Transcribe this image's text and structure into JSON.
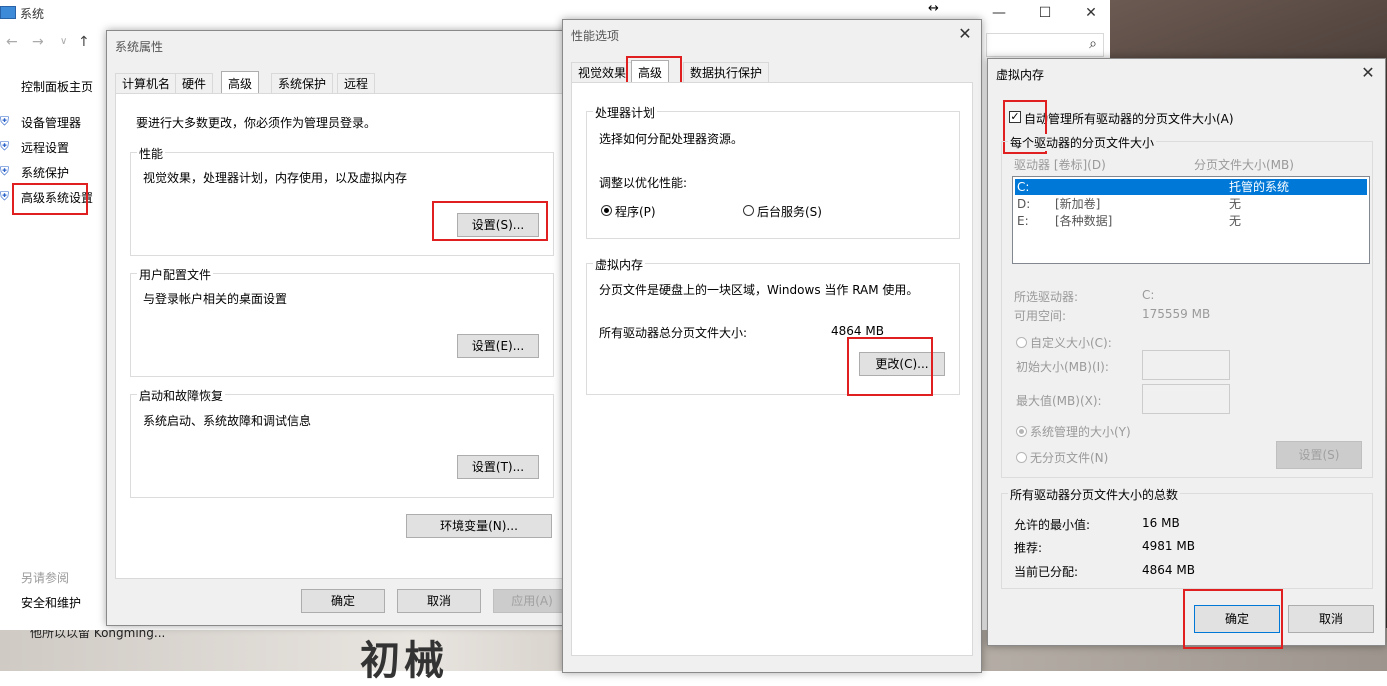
{
  "system_window": {
    "title": "系统",
    "control_panel_home": "控制面板主页",
    "sidebar_links": [
      "设备管理器",
      "远程设置",
      "系统保护",
      "高级系统设置"
    ],
    "see_also_title": "另请参阅",
    "see_also_link": "安全和维护",
    "min_glyph": "—",
    "max_glyph": "☐",
    "close_glyph": "✕",
    "resize_glyph": "↔",
    "search_glyph": "⌕"
  },
  "background": {
    "caption": "他所以以留   Kongming...",
    "big_text": "初械"
  },
  "system_properties": {
    "title": "系统属性",
    "tabs": [
      "计算机名",
      "硬件",
      "高级",
      "系统保护",
      "远程"
    ],
    "admin_note": "要进行大多数更改，你必须作为管理员登录。",
    "performance": {
      "label": "性能",
      "desc": "视觉效果，处理器计划，内存使用，以及虚拟内存",
      "button": "设置(S)..."
    },
    "user_profiles": {
      "label": "用户配置文件",
      "desc": "与登录帐户相关的桌面设置",
      "button": "设置(E)..."
    },
    "startup": {
      "label": "启动和故障恢复",
      "desc": "系统启动、系统故障和调试信息",
      "button": "设置(T)..."
    },
    "env_button": "环境变量(N)...",
    "ok": "确定",
    "cancel": "取消",
    "apply": "应用(A)"
  },
  "performance_options": {
    "title": "性能选项",
    "tabs": [
      "视觉效果",
      "高级",
      "数据执行保护"
    ],
    "processor": {
      "label": "处理器计划",
      "desc": "选择如何分配处理器资源。",
      "adjust": "调整以优化性能:",
      "opt_programs": "程序(P)",
      "opt_background": "后台服务(S)"
    },
    "virtual_memory": {
      "label": "虚拟内存",
      "desc": "分页文件是硬盘上的一块区域，Windows 当作 RAM 使用。",
      "total_label": "所有驱动器总分页文件大小:",
      "total_value": "4864 MB",
      "change_button": "更改(C)..."
    }
  },
  "virtual_memory_dialog": {
    "title": "虚拟内存",
    "auto_manage": "自动管理所有驱动器的分页文件大小(A)",
    "per_drive_label": "每个驱动器的分页文件大小",
    "col_drive": "驱动器 [卷标](D)",
    "col_size": "分页文件大小(MB)",
    "drives": [
      {
        "drive": "C:",
        "label": "",
        "size": "托管的系统"
      },
      {
        "drive": "D:",
        "label": "[新加卷]",
        "size": "无"
      },
      {
        "drive": "E:",
        "label": "[各种数据]",
        "size": "无"
      }
    ],
    "selected_drive_label": "所选驱动器:",
    "selected_drive_value": "C:",
    "free_space_label": "可用空间:",
    "free_space_value": "175559 MB",
    "custom_size": "自定义大小(C):",
    "initial_size": "初始大小(MB)(I):",
    "max_size": "最大值(MB)(X):",
    "system_managed": "系统管理的大小(Y)",
    "no_paging": "无分页文件(N)",
    "set_button": "设置(S)",
    "totals_label": "所有驱动器分页文件大小的总数",
    "min_allowed_label": "允许的最小值:",
    "min_allowed_value": "16 MB",
    "recommended_label": "推荐:",
    "recommended_value": "4981 MB",
    "current_label": "当前已分配:",
    "current_value": "4864 MB",
    "ok": "确定",
    "cancel": "取消"
  },
  "colors": {
    "highlight": "#e02020",
    "selection": "#0078d7"
  }
}
